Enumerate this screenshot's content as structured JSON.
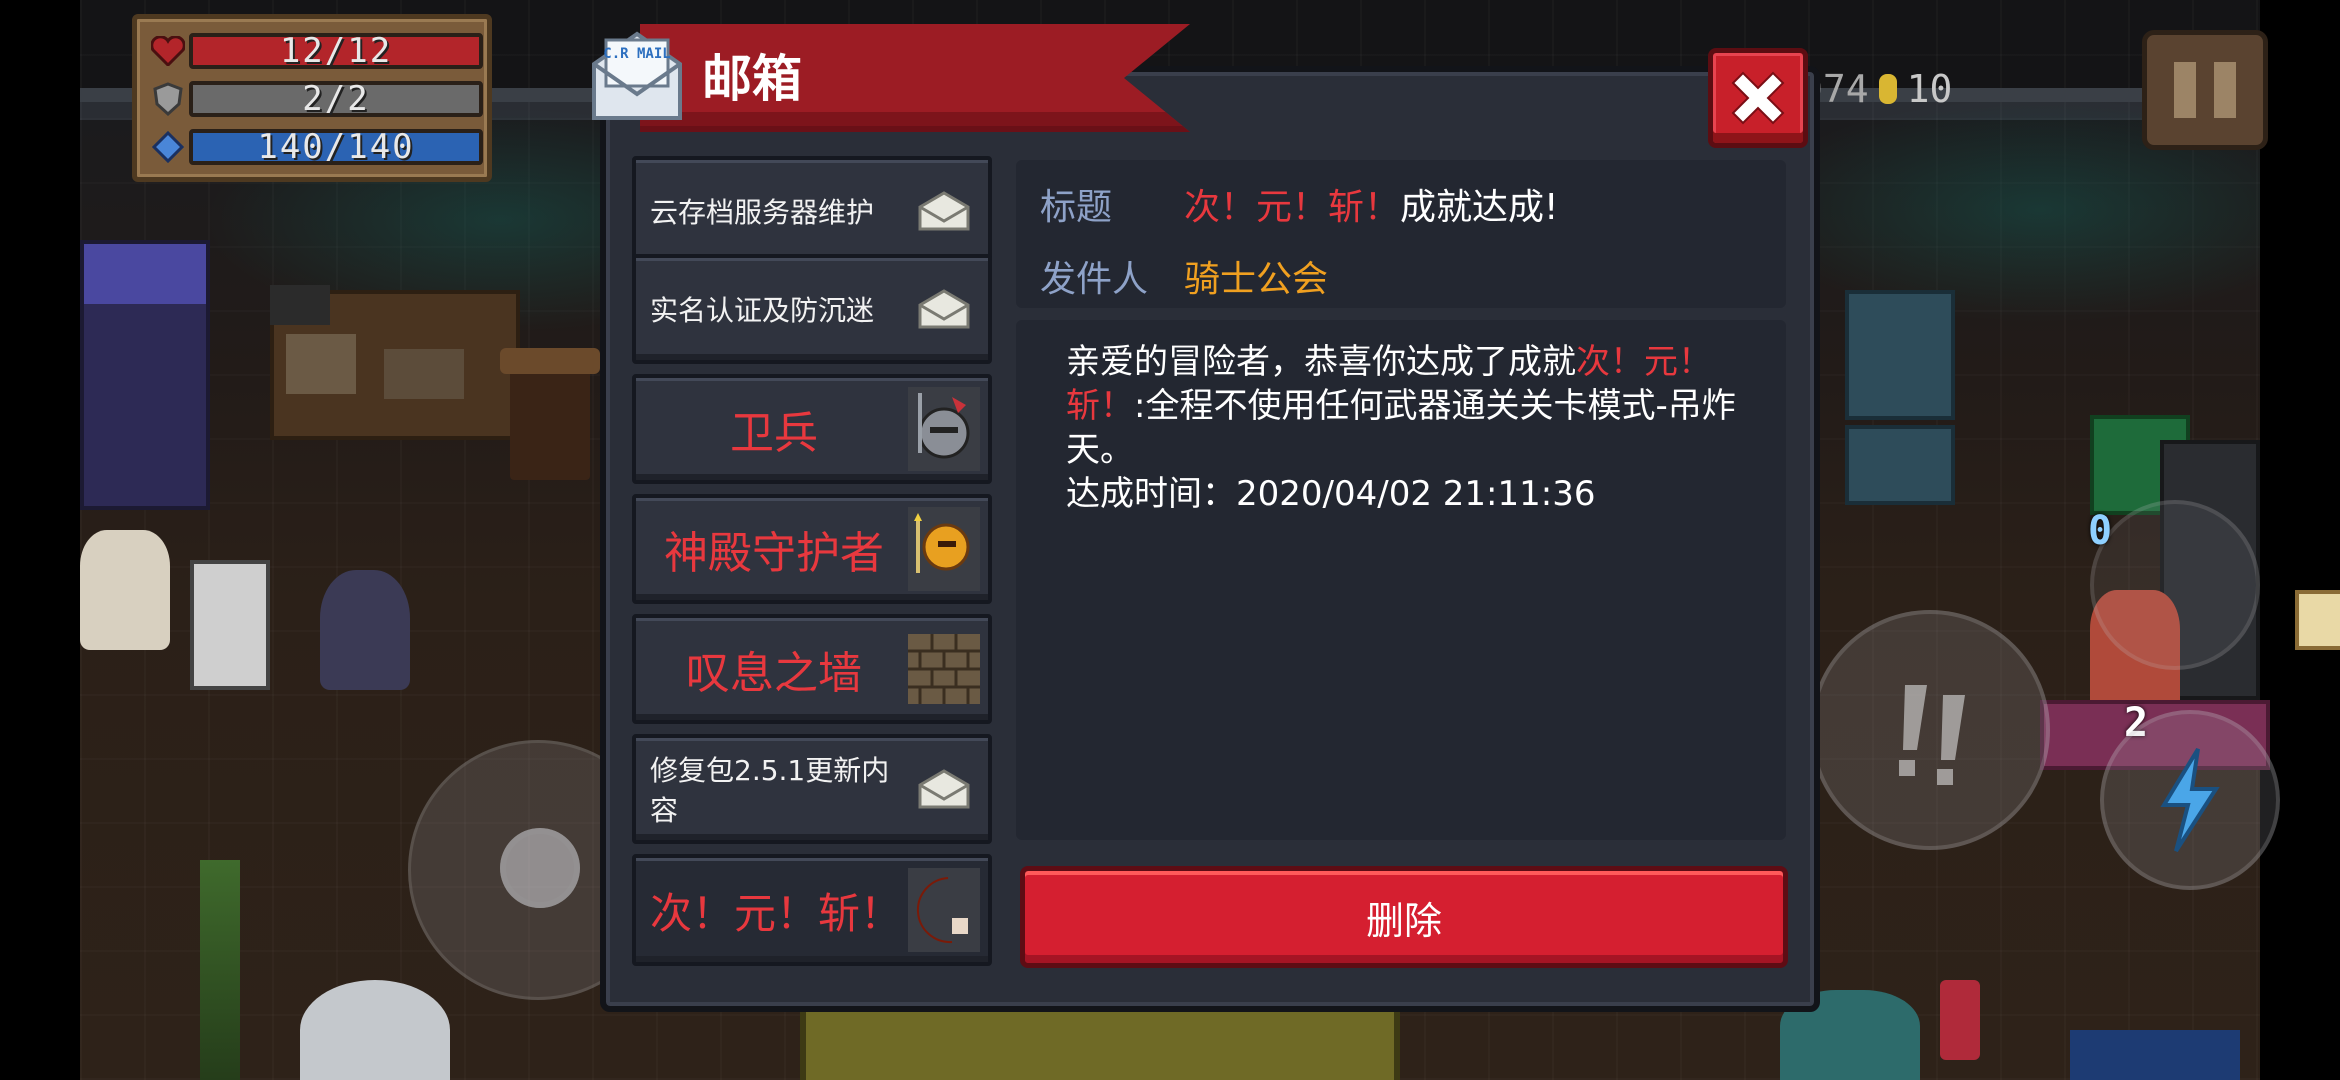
{
  "hud": {
    "hp": "12/12",
    "armor": "2/2",
    "energy": "140/140",
    "gems": "074",
    "coins": "10"
  },
  "mailbox": {
    "title": "邮箱",
    "icon_text": "C.R MAIL",
    "mails": [
      {
        "label": "云存档服务器维护",
        "style": "small",
        "thumb": "envelope-icon"
      },
      {
        "label": "实名认证及防沉迷",
        "style": "small",
        "thumb": "envelope-icon"
      },
      {
        "label": "卫兵",
        "style": "big",
        "thumb": "guard-helmet-icon"
      },
      {
        "label": "神殿守护者",
        "style": "big",
        "thumb": "temple-guardian-icon"
      },
      {
        "label": "叹息之墙",
        "style": "big",
        "thumb": "wall-icon"
      },
      {
        "label": "修复包2.5.1更新内容",
        "style": "small",
        "thumb": "envelope-icon"
      },
      {
        "label": "次！元！斩！",
        "style": "mid",
        "thumb": "crescent-slash-icon",
        "selected": true
      }
    ],
    "detail": {
      "subject_label": "标题",
      "subject_red": "次！元！斩！",
      "subject_rest": "成就达成!",
      "sender_label": "发件人",
      "sender": "骑士公会",
      "body_intro": "亲爱的冒险者，恭喜你达成了成就",
      "body_achievement": "次！元！斩！",
      "body_desc": ":全程不使用任何武器通关关卡模式-吊炸天。",
      "body_time": "达成时间：2020/04/02 21:11:36"
    },
    "delete_label": "删除"
  },
  "controls": {
    "weapon_slot": "0",
    "ammo_badge": "2"
  },
  "colors": {
    "accent_red": "#e8383e",
    "sender_orange": "#f0a020",
    "label_blue": "#8ea2c8",
    "delete_red": "#d51f30"
  }
}
